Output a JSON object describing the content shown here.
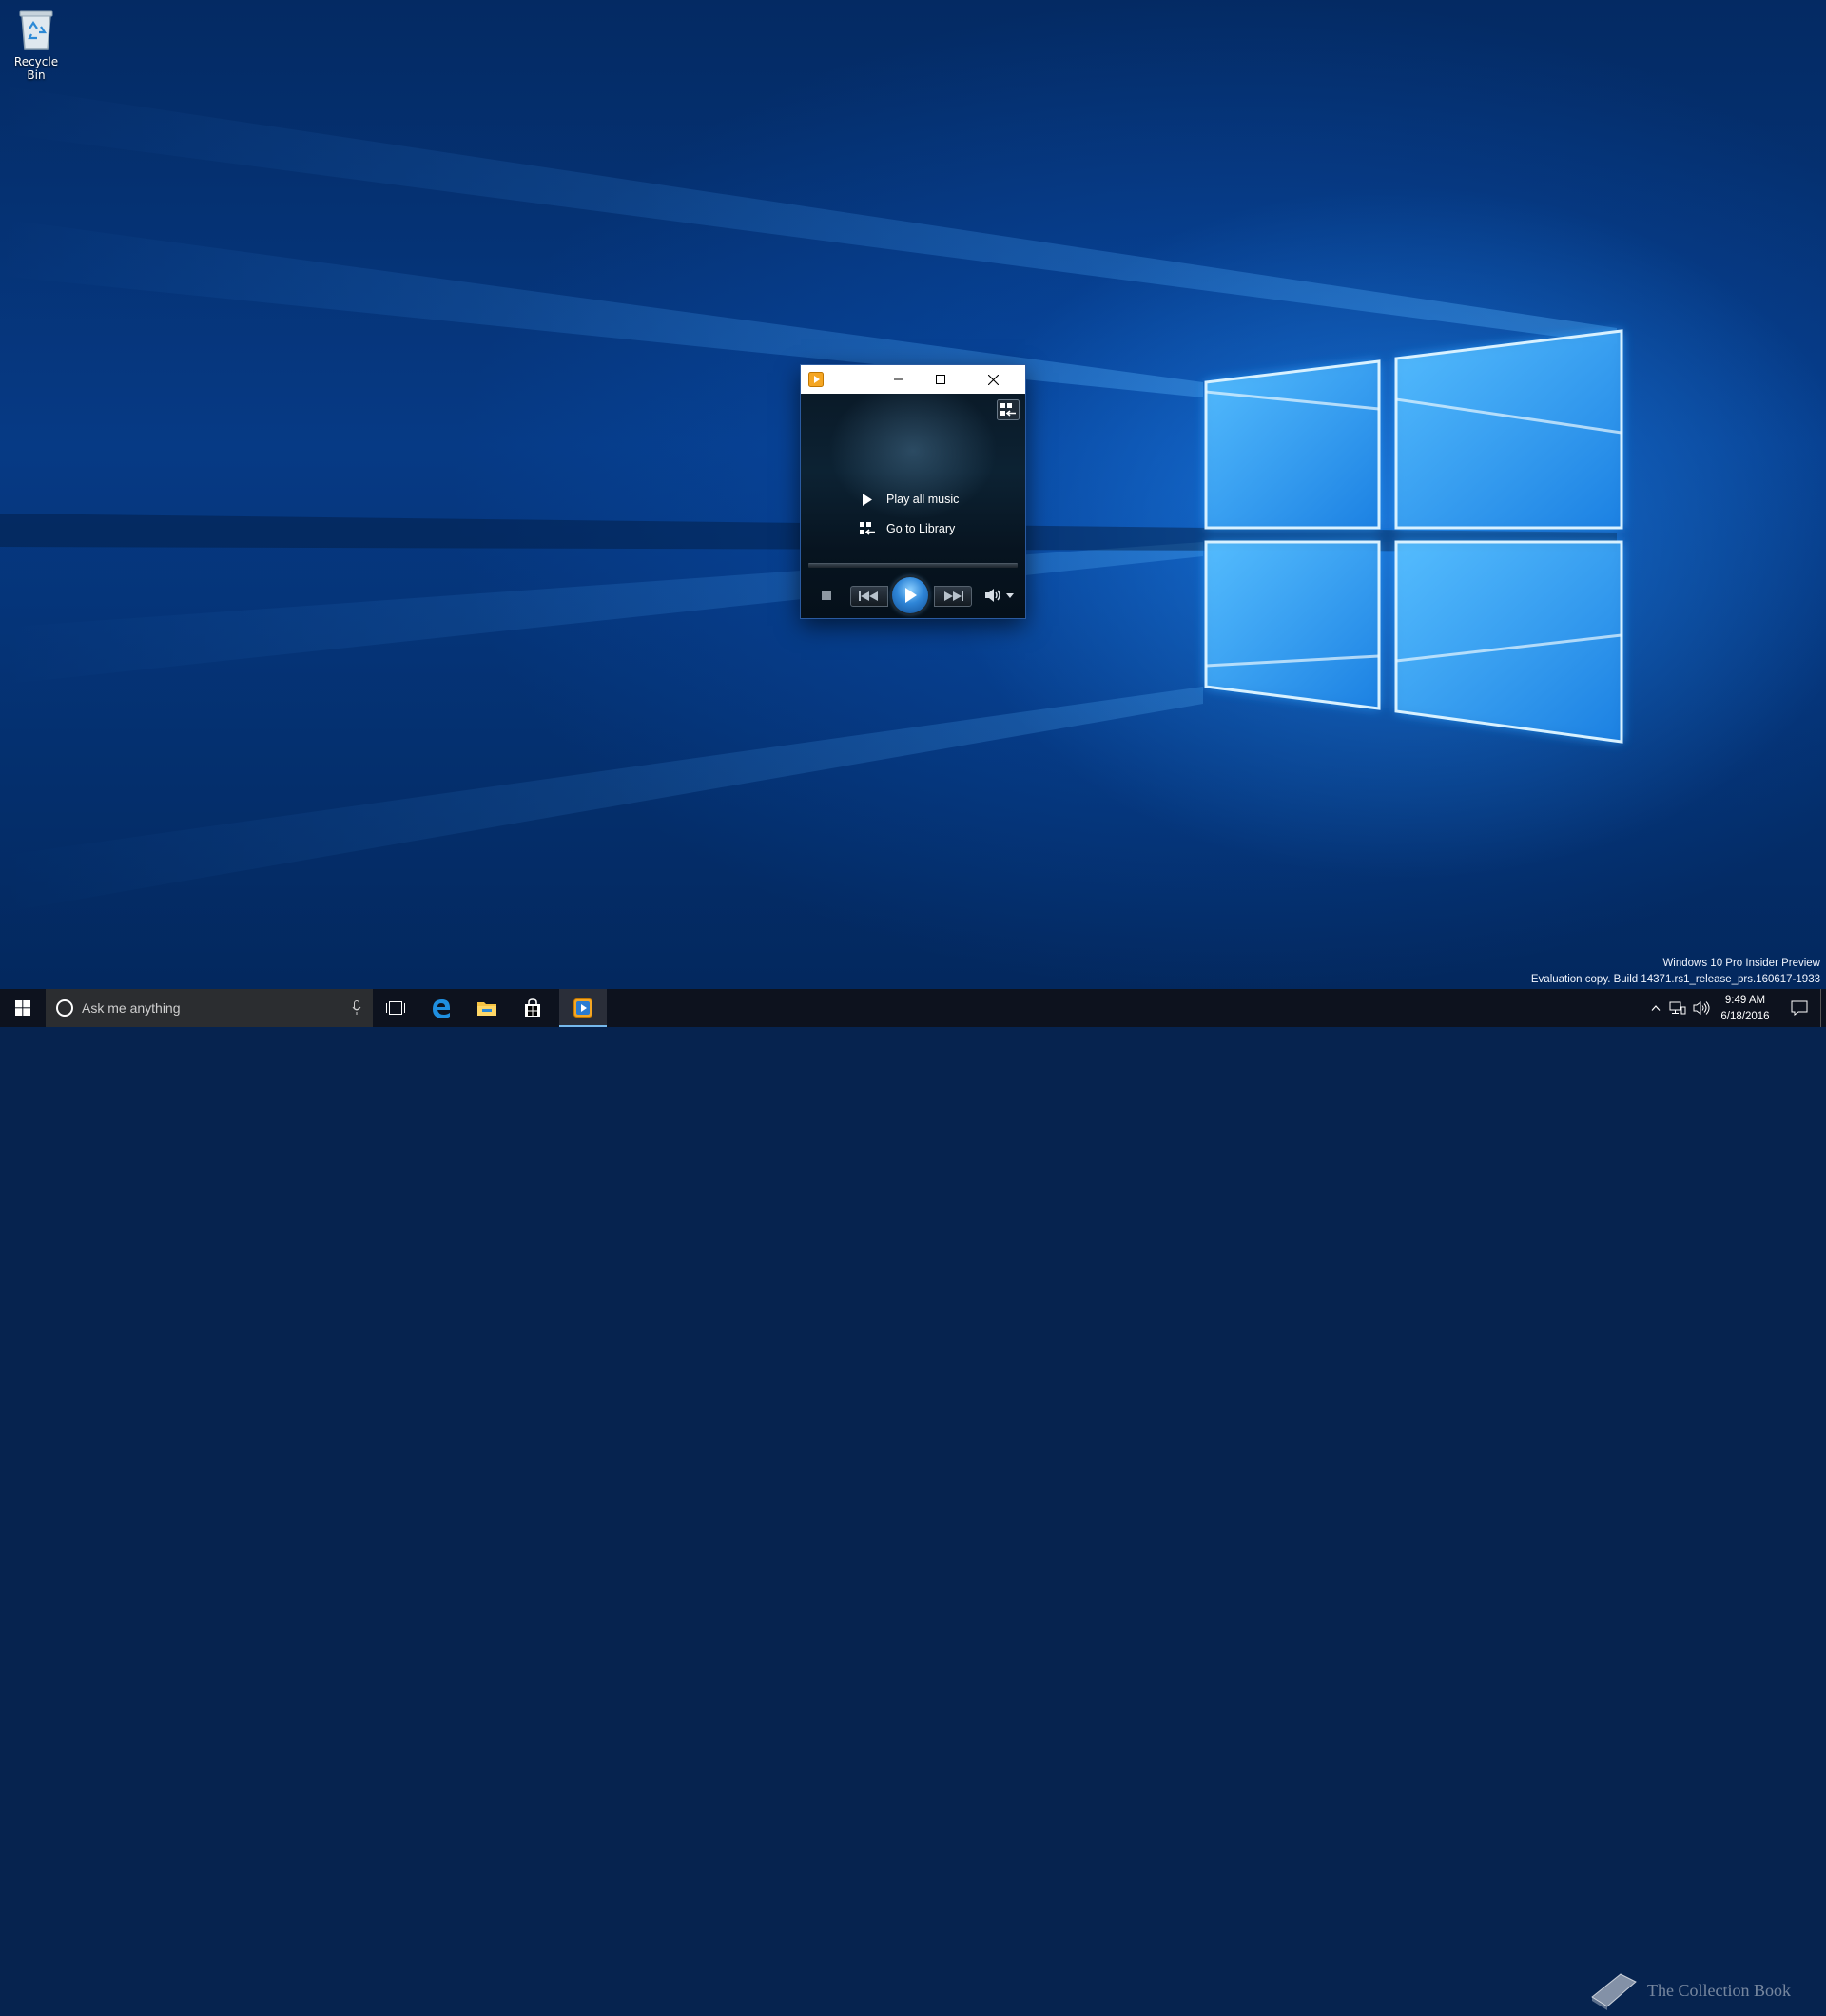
{
  "desktop": {
    "icons": [
      {
        "label": "Recycle Bin",
        "icon": "recycle-bin-icon"
      }
    ],
    "watermark": {
      "line1": "Windows 10 Pro Insider Preview",
      "line2": "Evaluation copy. Build 14371.rs1_release_prs.160617-1933"
    },
    "site_watermark": "The Collection Book"
  },
  "player": {
    "app_icon": "windows-media-player-icon",
    "titlebar": {
      "minimize": "minimize-icon",
      "maximize": "maximize-icon",
      "close": "close-icon"
    },
    "switch_to_library_icon": "switch-to-library-icon",
    "actions": {
      "play_all": "Play all music",
      "go_to_library": "Go to Library"
    },
    "controls": [
      "stop",
      "previous",
      "play",
      "next",
      "mute",
      "volume"
    ]
  },
  "taskbar": {
    "search": {
      "placeholder": "Ask me anything"
    },
    "pinned": [
      "task-view-icon",
      "edge-icon",
      "file-explorer-icon",
      "store-icon",
      "windows-media-player-icon"
    ],
    "clock": {
      "time": "9:49 AM",
      "date": "6/18/2016"
    },
    "accent": "#76b9ed"
  }
}
